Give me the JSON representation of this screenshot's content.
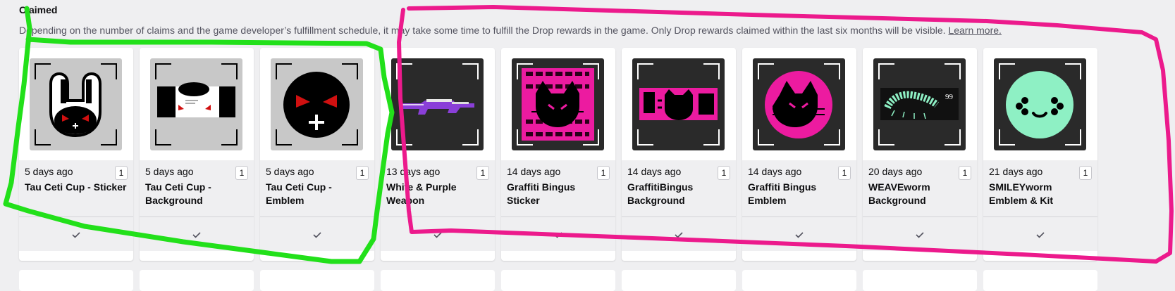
{
  "section": {
    "heading": "Claimed",
    "description": "Depending on the number of claims and the game developer’s fulfillment schedule, it may take some time to fulfill the Drop rewards in the game. Only Drop rewards claimed within the last six months will be visible.",
    "learn_more": "Learn more."
  },
  "cards": [
    {
      "age": "5 days ago",
      "qty": "1",
      "name": "Tau Ceti Cup - Sticker",
      "image": "bunny-sticker"
    },
    {
      "age": "5 days ago",
      "qty": "1",
      "name": "Tau Ceti Cup - Background",
      "image": "bunny-background"
    },
    {
      "age": "5 days ago",
      "qty": "1",
      "name": "Tau Ceti Cup - Emblem",
      "image": "skull-emblem"
    },
    {
      "age": "13 days ago",
      "qty": "1",
      "name": "White & Purple Weapon",
      "image": "rifle"
    },
    {
      "age": "14 days ago",
      "qty": "1",
      "name": "Graffiti Bingus Sticker",
      "image": "bingus-sticker"
    },
    {
      "age": "14 days ago",
      "qty": "1",
      "name": "GraffitiBingus Background",
      "image": "bingus-background"
    },
    {
      "age": "14 days ago",
      "qty": "1",
      "name": "Graffiti Bingus Emblem",
      "image": "bingus-emblem"
    },
    {
      "age": "20 days ago",
      "qty": "1",
      "name": "WEAVEworm Background",
      "image": "worm-background",
      "badge_text": "99"
    },
    {
      "age": "21 days ago",
      "qty": "1",
      "name": "SMILEYworm Emblem & Kit",
      "image": "smiley-emblem"
    }
  ],
  "icons": {
    "claimed": "checkmark-icon"
  },
  "colors": {
    "green_annotation": "#22e01a",
    "pink_annotation": "#ec1a8c",
    "graffiti_pink": "#ec1ba0",
    "smiley_green": "#8ef0c4"
  }
}
